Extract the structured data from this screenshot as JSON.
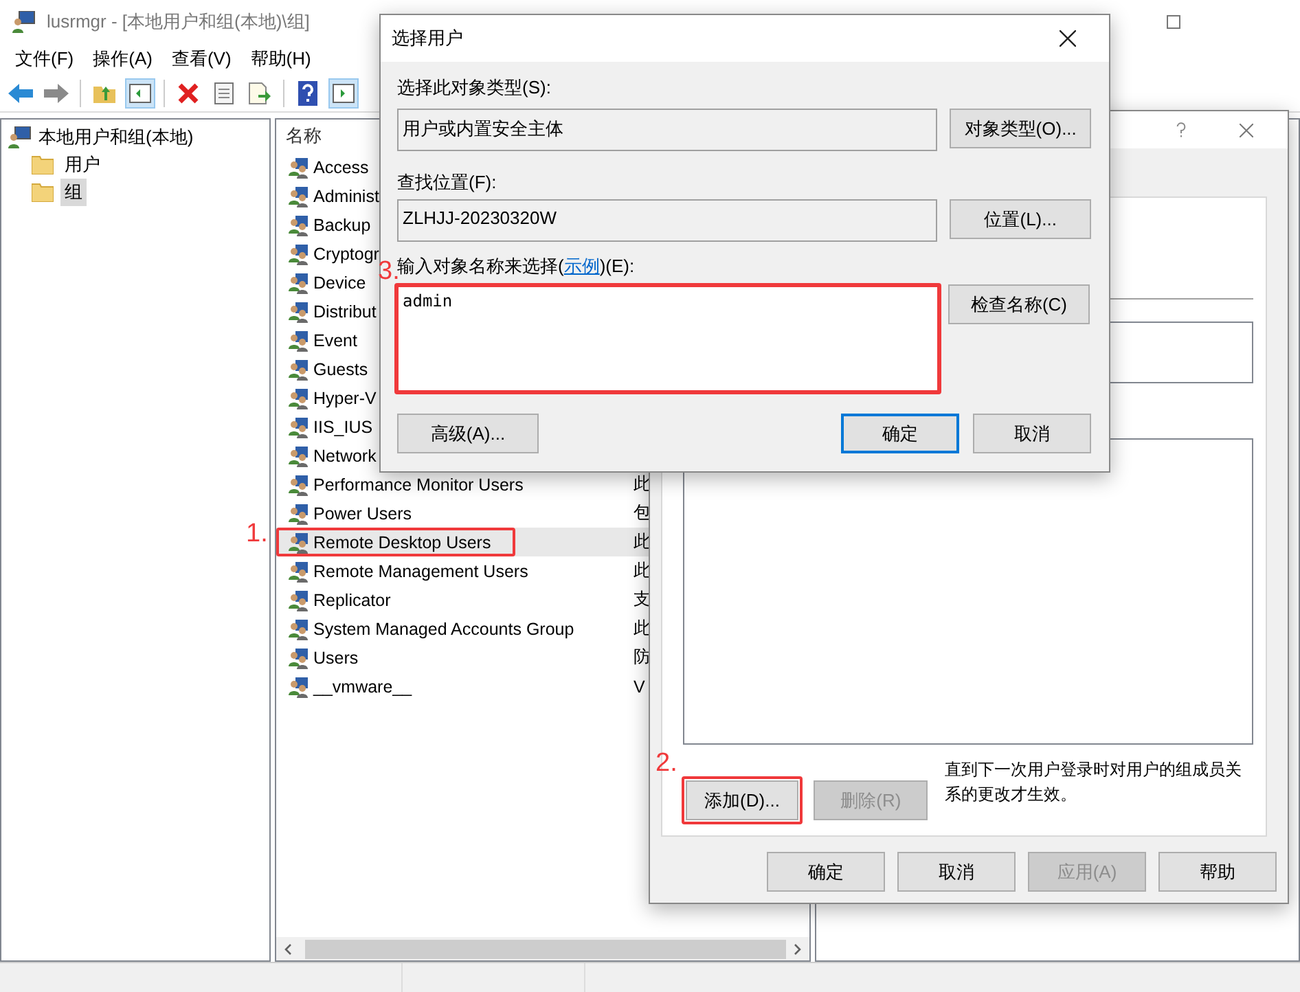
{
  "window": {
    "title": "lusrmgr - [本地用户和组(本地)\\组]"
  },
  "menu": [
    "文件(F)",
    "操作(A)",
    "查看(V)",
    "帮助(H)"
  ],
  "toolbar": [
    {
      "kind": "back",
      "pressed": false
    },
    {
      "kind": "forward",
      "pressed": false
    },
    {
      "kind": "sep"
    },
    {
      "kind": "up",
      "pressed": false
    },
    {
      "kind": "tree",
      "pressed": true
    },
    {
      "kind": "sep"
    },
    {
      "kind": "delete",
      "pressed": false
    },
    {
      "kind": "properties",
      "pressed": false
    },
    {
      "kind": "export",
      "pressed": false
    },
    {
      "kind": "sep"
    },
    {
      "kind": "help",
      "pressed": false
    },
    {
      "kind": "actions",
      "pressed": true
    }
  ],
  "tree": {
    "label": "本地用户和组(本地)",
    "children": [
      {
        "label": "用户",
        "selected": false
      },
      {
        "label": "组",
        "selected": true
      }
    ]
  },
  "list": {
    "columns": [
      "名称"
    ],
    "rows": [
      {
        "name": "Access",
        "selected": false
      },
      {
        "name": "Administ",
        "selected": false
      },
      {
        "name": "Backup",
        "selected": false
      },
      {
        "name": "Cryptogr",
        "selected": false
      },
      {
        "name": "Device",
        "selected": false
      },
      {
        "name": "Distribut",
        "selected": false
      },
      {
        "name": "Event",
        "selected": false
      },
      {
        "name": "Guests",
        "selected": false
      },
      {
        "name": "Hyper-V",
        "selected": false
      },
      {
        "name": "IIS_IUS",
        "selected": false
      },
      {
        "name": "Network",
        "selected": false
      },
      {
        "name": "Performance Monitor Users",
        "column_2": "此",
        "selected": false
      },
      {
        "name": "Power Users",
        "column_2": "包",
        "selected": false
      },
      {
        "name": "Remote Desktop Users",
        "column_2": "此",
        "selected": true,
        "callout": "1."
      },
      {
        "name": "Remote Management Users",
        "column_2": "此",
        "selected": false
      },
      {
        "name": "Replicator",
        "column_2": "支",
        "selected": false
      },
      {
        "name": "System Managed Accounts Group",
        "column_2": "此",
        "selected": false
      },
      {
        "name": "Users",
        "column_2": "防",
        "selected": false
      },
      {
        "name": "__vmware__",
        "column_2": "V",
        "selected": false
      }
    ]
  },
  "properties_dialog": {
    "members_add": {
      "label": "添加(D)...",
      "callout": "2.",
      "disabled": false
    },
    "members_remove": {
      "label": "删除(R)",
      "disabled": true
    },
    "note": "直到下一次用户登录时对用户的组成员关系的更改才生效。",
    "buttons": [
      {
        "label": "确定",
        "disabled": false
      },
      {
        "label": "取消",
        "disabled": false
      },
      {
        "label": "应用(A)",
        "disabled": true
      },
      {
        "label": "帮助",
        "disabled": false
      }
    ]
  },
  "select_dialog": {
    "title": "选择用户",
    "object_type": {
      "label": "选择此对象类型(S):",
      "value": "用户或内置安全主体",
      "button": "对象类型(O)..."
    },
    "location": {
      "label": "查找位置(F):",
      "value": "ZLHJJ-20230320W",
      "button": "位置(L)..."
    },
    "names": {
      "label_before": "输入对象名称来选择(",
      "link": "示例",
      "label_after": ")(E):",
      "value": "admin",
      "callout": "3.",
      "button": "检查名称(C)"
    },
    "advanced": "高级(A)...",
    "buttons": [
      {
        "label": "确定",
        "default": true
      },
      {
        "label": "取消",
        "default": false
      }
    ]
  }
}
